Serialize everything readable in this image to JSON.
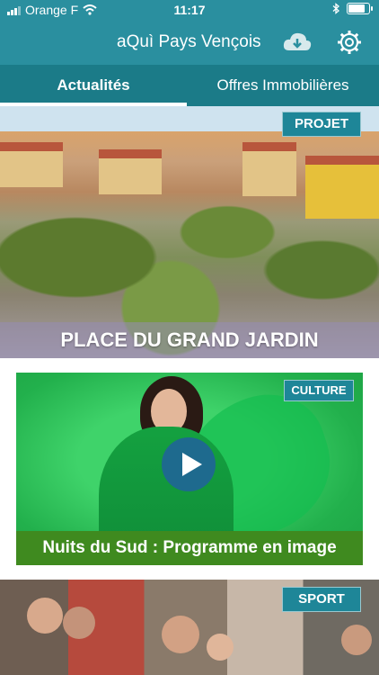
{
  "status_bar": {
    "carrier": "Orange F",
    "time": "11:17"
  },
  "header": {
    "title": "aQuì Pays Vençois"
  },
  "tabs": [
    {
      "label": "Actualités",
      "active": true
    },
    {
      "label": "Offres Immobilières",
      "active": false
    }
  ],
  "articles": [
    {
      "badge": "PROJET",
      "title": "PLACE DU GRAND JARDIN"
    },
    {
      "badge": "CULTURE",
      "title": "Nuits du Sud : Programme en image"
    },
    {
      "badge": "SPORT"
    }
  ],
  "colors": {
    "primary": "#2a8f9f",
    "tab_bar": "#1b7b88",
    "badge": "#1e8698",
    "caption_green": "#3f8a1f"
  }
}
